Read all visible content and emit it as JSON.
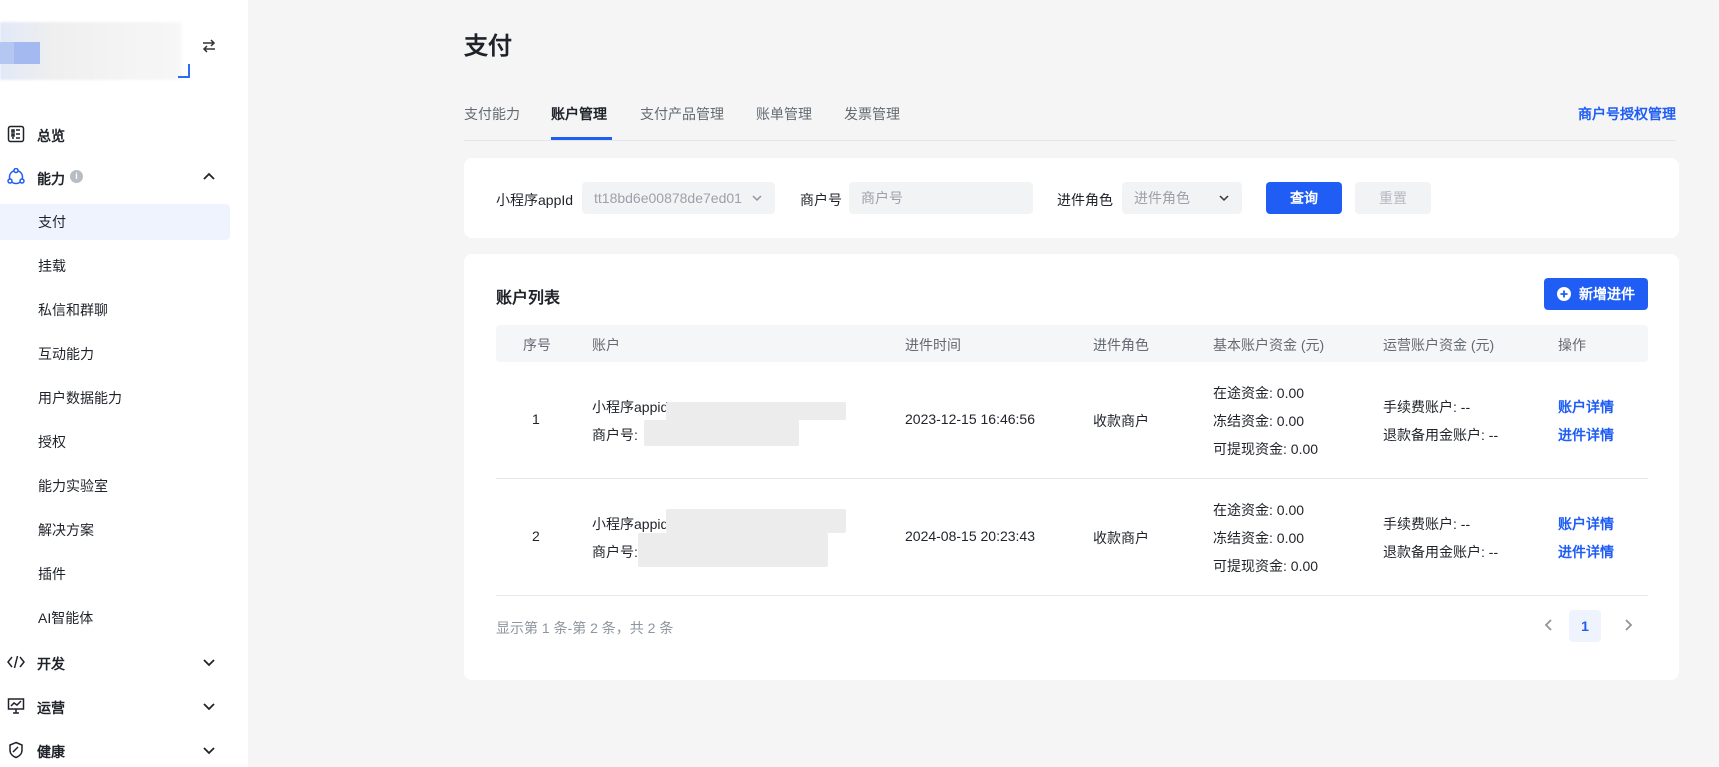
{
  "sidebar": {
    "groups": {
      "overview": "总览",
      "capability": "能力",
      "develop": "开发",
      "operate": "运营",
      "health": "健康"
    },
    "items": [
      {
        "label": "支付",
        "active": true
      },
      {
        "label": "挂载"
      },
      {
        "label": "私信和群聊"
      },
      {
        "label": "互动能力"
      },
      {
        "label": "用户数据能力"
      },
      {
        "label": "授权"
      },
      {
        "label": "能力实验室"
      },
      {
        "label": "解决方案"
      },
      {
        "label": "插件"
      },
      {
        "label": "AI智能体"
      }
    ]
  },
  "page": {
    "title": "支付",
    "tabs": [
      "支付能力",
      "账户管理",
      "支付产品管理",
      "账单管理",
      "发票管理"
    ],
    "active_tab": "账户管理",
    "right_link": "商户号授权管理"
  },
  "filters": {
    "appid_label": "小程序appId",
    "appid_value": "tt18bd6e00878de7ed01",
    "merchant_label": "商户号",
    "merchant_placeholder": "商户号",
    "role_label": "进件角色",
    "role_placeholder": "进件角色",
    "query_button": "查询",
    "reset_button": "重置"
  },
  "list": {
    "title": "账户列表",
    "add_button": "新增进件",
    "columns": [
      "序号",
      "账户",
      "进件时间",
      "进件角色",
      "基本账户资金 (元)",
      "运营账户资金 (元)",
      "操作"
    ],
    "rows": [
      {
        "index": "1",
        "appid_line": "小程序appid:",
        "merchant_line": "商户号: ",
        "time": "2023-12-15 16:46:56",
        "role": "收款商户",
        "transit": "在途资金: 0.00",
        "frozen": "冻结资金: 0.00",
        "withdrawable": "可提现资金: 0.00",
        "fee_account": "手续费账户: --",
        "refund_account": "退款备用金账户: --",
        "action_detail": "账户详情",
        "action_apply": "进件详情"
      },
      {
        "index": "2",
        "appid_line": "小程序appid",
        "merchant_line": "商户号:",
        "time": "2024-08-15 20:23:43",
        "role": "收款商户",
        "transit": "在途资金: 0.00",
        "frozen": "冻结资金: 0.00",
        "withdrawable": "可提现资金: 0.00",
        "fee_account": "手续费账户: --",
        "refund_account": "退款备用金账户: --",
        "action_detail": "账户详情",
        "action_apply": "进件详情"
      }
    ],
    "summary": "显示第 1 条-第 2 条，共 2 条",
    "current_page": "1"
  },
  "colors": {
    "accent": "#1f5df5",
    "sidebar_active_bg": "#eef3fe",
    "page_bg": "#f5f5f5"
  }
}
